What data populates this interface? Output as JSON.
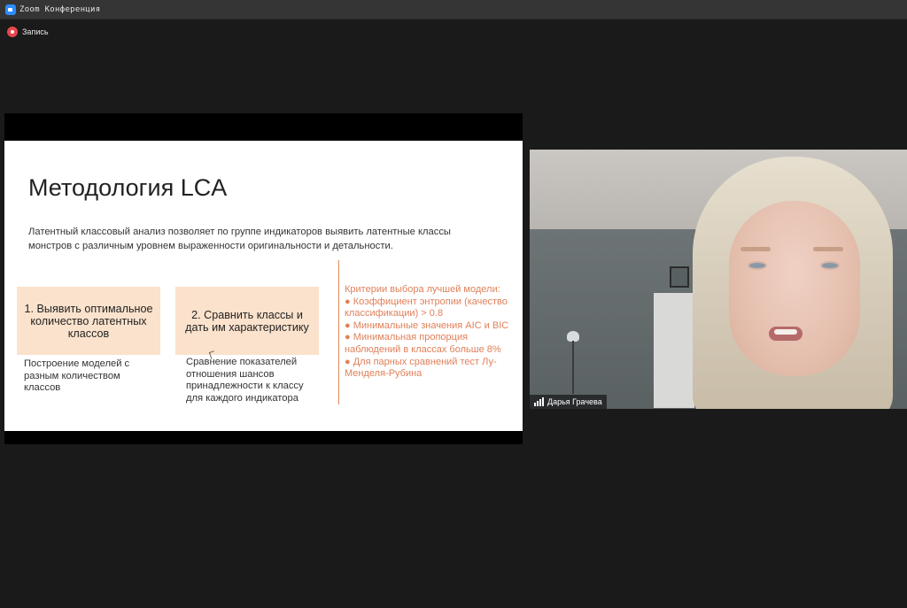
{
  "window": {
    "title": "Zoom Конференция",
    "icon": "zoom-logo-icon"
  },
  "recording": {
    "label": "Запись",
    "icon": "record-icon"
  },
  "slide": {
    "title": "Методология LCA",
    "intro": "Латентный классовый анализ позволяет по группе индикаторов выявить латентные классы монстров с различным уровнем выраженности оригинальности  и детальности.",
    "block1_title": "1. Выявить оптимальное количество латентных классов",
    "block1_desc": "Построение моделей с разным количеством классов",
    "block2_title": "2. Сравнить классы и дать им характеристику",
    "block2_desc": "Сравнение показателей отношения шансов принадлежности к классу для каждого индикатора",
    "criteria_title": "Критерии выбора лучшей модели:",
    "criteria": [
      "● Коэффициент энтропии (качество классификации) > 0.8",
      "● Минимальные значения AIC и BIC",
      "● Минимальная пропорция наблюдений в классах больше 8%",
      "● Для парных сравнений тест Лу-Менделя-Рубина"
    ],
    "accent_color": "#e0805a",
    "block_color": "#fbe2cc"
  },
  "participant": {
    "name": "Дарья Грачева",
    "icon": "signal-strength-icon"
  }
}
